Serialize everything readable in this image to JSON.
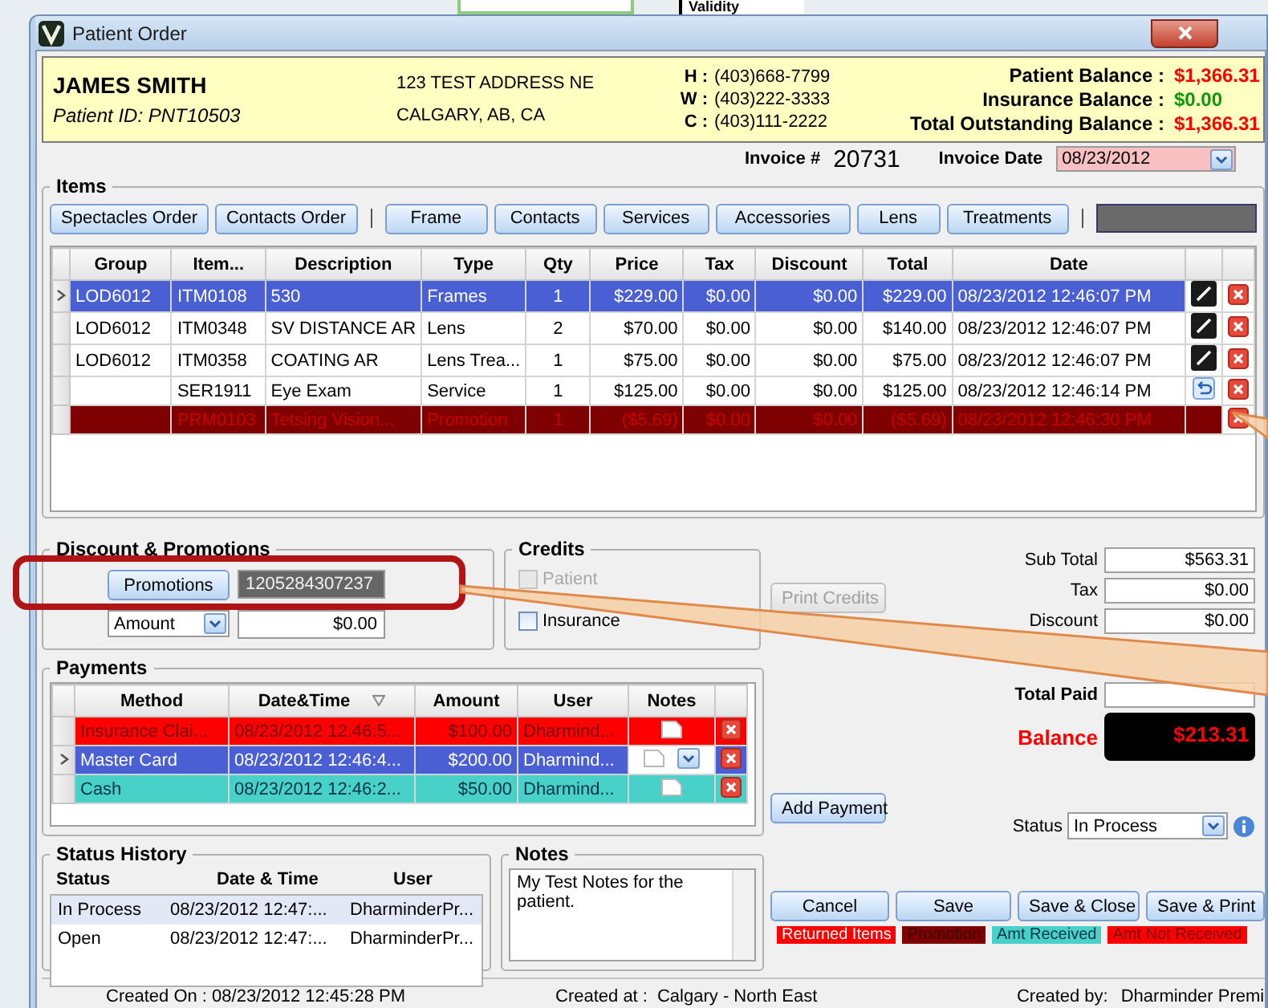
{
  "background_window": {
    "label": "Validity"
  },
  "window": {
    "title": "Patient Order"
  },
  "patient": {
    "name": "JAMES SMITH",
    "id_label": "Patient ID: PNT10503",
    "address_line_1": "123 TEST ADDRESS NE",
    "address_line_2": "CALGARY, AB, CA",
    "phones": [
      {
        "label": "H :",
        "number": "(403)668-7799"
      },
      {
        "label": "W :",
        "number": "(403)222-3333"
      },
      {
        "label": "C :",
        "number": "(403)111-2222"
      }
    ],
    "balances": [
      {
        "label": "Patient Balance :",
        "value": "$1,366.31",
        "kind": "due"
      },
      {
        "label": "Insurance Balance :",
        "value": "$0.00",
        "kind": "clear"
      },
      {
        "label": "Total Outstanding Balance :",
        "value": "$1,366.31",
        "kind": "due"
      }
    ]
  },
  "invoice": {
    "number_label": "Invoice #",
    "number": "20731",
    "date_label": "Invoice Date",
    "date": "08/23/2012"
  },
  "items": {
    "title": "Items",
    "order_buttons": [
      "Spectacles Order",
      "Contacts Order"
    ],
    "category_buttons": [
      "Frame",
      "Contacts",
      "Services",
      "Accessories",
      "Lens",
      "Treatments"
    ],
    "columns": [
      "Group",
      "Item...",
      "Description",
      "Type",
      "Qty",
      "Price",
      "Tax",
      "Discount",
      "Total",
      "Date"
    ],
    "rows": [
      {
        "group": "LOD6012",
        "item": "ITM0108",
        "description": "530",
        "type": "Frames",
        "qty": "1",
        "price": "$229.00",
        "tax": "$0.00",
        "discount": "$0.00",
        "total": "$229.00",
        "date": "08/23/2012 12:46:07 PM",
        "selected": true,
        "editable": true,
        "returnable": false
      },
      {
        "group": "LOD6012",
        "item": "ITM0348",
        "description": "SV DISTANCE AR",
        "type": "Lens",
        "qty": "2",
        "price": "$70.00",
        "tax": "$0.00",
        "discount": "$0.00",
        "total": "$140.00",
        "date": "08/23/2012 12:46:07 PM",
        "kind": "normal",
        "selected": false,
        "editable": true,
        "returnable": false
      },
      {
        "group": "LOD6012",
        "item": "ITM0358",
        "description": "COATING AR",
        "type": "Lens Trea...",
        "qty": "1",
        "price": "$75.00",
        "tax": "$0.00",
        "discount": "$0.00",
        "total": "$75.00",
        "date": "08/23/2012 12:46:07 PM",
        "kind": "normal",
        "selected": false,
        "editable": true,
        "returnable": false
      },
      {
        "item": "SER1911",
        "description": "Eye Exam",
        "type": "Service",
        "qty": "1",
        "price": "$125.00",
        "tax": "$0.00",
        "discount": "$0.00",
        "total": "$125.00",
        "date": "08/23/2012 12:46:14 PM",
        "kind": "normal",
        "selected": false,
        "editable": false,
        "returnable": true
      },
      {
        "item": "PRM0103",
        "description": "Tetsing Vision...",
        "type": "Promotion",
        "qty": "1",
        "price": "($5.69)",
        "tax": "$0.00",
        "discount": "$0.00",
        "total": "($5.69)",
        "date": "08/23/2012 12:46:30 PM",
        "kind": "promotion",
        "selected": false,
        "editable": false,
        "returnable": false
      }
    ]
  },
  "discount": {
    "title": "Discount & Promotions",
    "promotions_button": "Promotions",
    "promo_code": "1205284307237",
    "discount_type": "Amount",
    "discount_value": "$0.00"
  },
  "credits": {
    "title": "Credits",
    "options": [
      {
        "label": "Patient",
        "checked": false,
        "disabled": true
      },
      {
        "label": "Insurance",
        "checked": false,
        "disabled": false
      }
    ],
    "print_button": "Print Credits"
  },
  "payments": {
    "title": "Payments",
    "columns": [
      "Method",
      "Date&Time",
      "Amount",
      "User",
      "Notes"
    ],
    "rows": [
      {
        "method": "Insurance Clai...",
        "date": "08/23/2012 12:46:5...",
        "amount": "$100.00",
        "user": "Dharmind...",
        "kind": "not_received",
        "selected": false
      },
      {
        "method": "Master Card",
        "date": "08/23/2012 12:46:4...",
        "amount": "$200.00",
        "user": "Dharmind...",
        "selected": true
      },
      {
        "method": "Cash",
        "date": "08/23/2012 12:46:2...",
        "amount": "$50.00",
        "user": "Dharmind...",
        "kind": "received",
        "selected": false
      }
    ],
    "add_button": "Add Payment"
  },
  "summary": {
    "rows": [
      {
        "label": "Sub Total",
        "value": "$563.31"
      },
      {
        "label": "Tax",
        "value": "$0.00"
      },
      {
        "label": "Discount",
        "value": "$0.00"
      }
    ],
    "total_paid_label": "Total Paid",
    "balance_label": "Balance",
    "balance": "$213.31"
  },
  "status": {
    "label": "Status",
    "value": "In Process"
  },
  "status_history": {
    "title": "Status History",
    "columns": [
      "Status",
      "Date & Time",
      "User"
    ],
    "rows": [
      {
        "status": "In Process",
        "date": "08/23/2012 12:47:...",
        "user": "DharminderPr...",
        "selected": true
      },
      {
        "status": "Open",
        "date": "08/23/2012 12:47:...",
        "user": "DharminderPr...",
        "selected": false
      }
    ]
  },
  "notes": {
    "title": "Notes",
    "text": "My Test Notes for the patient."
  },
  "actions": [
    "Cancel",
    "Save",
    "Save & Close",
    "Save & Print"
  ],
  "legend": [
    {
      "label": "Returned Items",
      "kind": "returned"
    },
    {
      "label": "Promotion",
      "kind": "promotion"
    },
    {
      "label": "Amt Received",
      "kind": "received"
    },
    {
      "label": "Amt Not Received",
      "kind": "not_received"
    }
  ],
  "footer": {
    "created_on": "Created On : 08/23/2012 12:45:28 PM",
    "created_at_label": "Created at :",
    "created_at": "Calgary - North East",
    "created_by_label": "Created by:",
    "created_by": "Dharminder Premi"
  }
}
